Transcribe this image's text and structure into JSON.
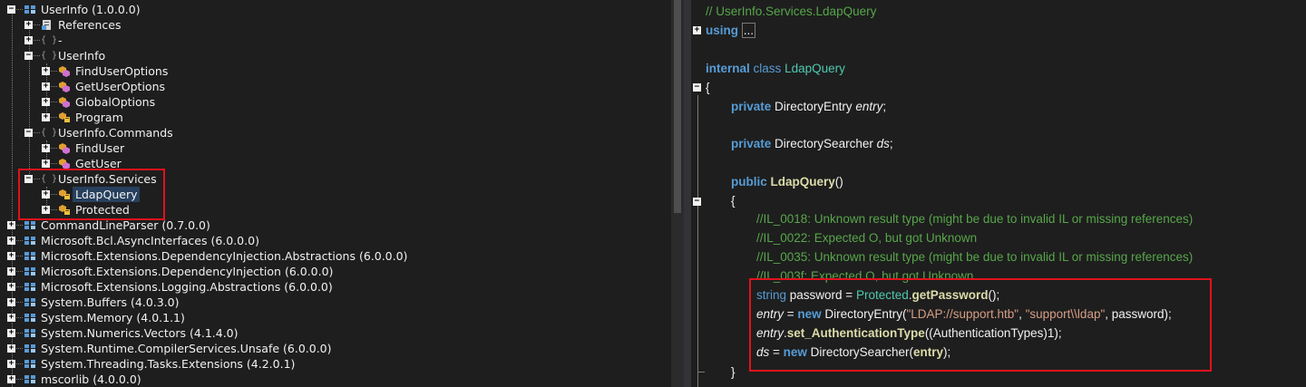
{
  "tree": {
    "items": [
      {
        "label": "UserInfo (1.0.0.0)",
        "level": 0,
        "icon": "assembly-icon",
        "state": "expanded"
      },
      {
        "label": "References",
        "level": 1,
        "icon": "references-icon",
        "state": "collapsed"
      },
      {
        "label": "-",
        "level": 1,
        "icon": "namespace-icon",
        "state": "collapsed"
      },
      {
        "label": "UserInfo",
        "level": 1,
        "icon": "namespace-icon",
        "state": "expanded"
      },
      {
        "label": "FindUserOptions",
        "level": 2,
        "icon": "class-icon",
        "state": "collapsed"
      },
      {
        "label": "GetUserOptions",
        "level": 2,
        "icon": "class-icon",
        "state": "collapsed"
      },
      {
        "label": "GlobalOptions",
        "level": 2,
        "icon": "class-icon",
        "state": "collapsed"
      },
      {
        "label": "Program",
        "level": 2,
        "icon": "internal-class-icon",
        "state": "collapsed"
      },
      {
        "label": "UserInfo.Commands",
        "level": 1,
        "icon": "namespace-icon",
        "state": "expanded"
      },
      {
        "label": "FindUser",
        "level": 2,
        "icon": "class-icon",
        "state": "collapsed"
      },
      {
        "label": "GetUser",
        "level": 2,
        "icon": "class-icon",
        "state": "collapsed"
      },
      {
        "label": "UserInfo.Services",
        "level": 1,
        "icon": "namespace-icon",
        "state": "expanded"
      },
      {
        "label": "LdapQuery",
        "level": 2,
        "icon": "internal-class-icon",
        "state": "collapsed",
        "selected": true
      },
      {
        "label": "Protected",
        "level": 2,
        "icon": "internal-class-icon",
        "state": "collapsed"
      },
      {
        "label": "CommandLineParser (0.7.0.0)",
        "level": 0,
        "icon": "assembly-icon",
        "state": "collapsed"
      },
      {
        "label": "Microsoft.Bcl.AsyncInterfaces (6.0.0.0)",
        "level": 0,
        "icon": "assembly-icon",
        "state": "collapsed"
      },
      {
        "label": "Microsoft.Extensions.DependencyInjection.Abstractions (6.0.0.0)",
        "level": 0,
        "icon": "assembly-icon",
        "state": "collapsed"
      },
      {
        "label": "Microsoft.Extensions.DependencyInjection (6.0.0.0)",
        "level": 0,
        "icon": "assembly-icon",
        "state": "collapsed"
      },
      {
        "label": "Microsoft.Extensions.Logging.Abstractions (6.0.0.0)",
        "level": 0,
        "icon": "assembly-icon",
        "state": "collapsed"
      },
      {
        "label": "System.Buffers (4.0.3.0)",
        "level": 0,
        "icon": "assembly-icon",
        "state": "collapsed"
      },
      {
        "label": "System.Memory (4.0.1.1)",
        "level": 0,
        "icon": "assembly-icon",
        "state": "collapsed"
      },
      {
        "label": "System.Numerics.Vectors (4.1.4.0)",
        "level": 0,
        "icon": "assembly-icon",
        "state": "collapsed"
      },
      {
        "label": "System.Runtime.CompilerServices.Unsafe (6.0.0.0)",
        "level": 0,
        "icon": "assembly-icon",
        "state": "collapsed"
      },
      {
        "label": "System.Threading.Tasks.Extensions (4.2.0.1)",
        "level": 0,
        "icon": "assembly-icon",
        "state": "collapsed"
      },
      {
        "label": "mscorlib (4.0.0.0)",
        "level": 0,
        "icon": "assembly-icon",
        "state": "collapsed"
      }
    ]
  },
  "code": {
    "header_comment": "// UserInfo.Services.LdapQuery",
    "using_kw": "using",
    "using_ellipsis": "...",
    "class_kw1": "internal",
    "class_kw2": "class",
    "class_name": "LdapQuery",
    "open_brace": "{",
    "field1_kw": "private",
    "field1_type": "DirectoryEntry",
    "field1_name": "entry",
    "field2_kw": "private",
    "field2_type": "DirectorySearcher",
    "field2_name": "ds",
    "ctor_kw": "public",
    "ctor_name": "LdapQuery",
    "ctor_parens": "()",
    "ctor_open": "{",
    "comments": [
      "//IL_0018: Unknown result type (might be due to invalid IL or missing references)",
      "//IL_0022: Expected O, but got Unknown",
      "//IL_0035: Unknown result type (might be due to invalid IL or missing references)",
      "//IL_003f: Expected O, but got Unknown"
    ],
    "l1": {
      "t1": "string",
      "t2": " password = ",
      "t3": "Protected",
      "t4": ".",
      "t5": "getPassword",
      "t6": "();"
    },
    "l2": {
      "t1": "entry",
      "t2": " = ",
      "t3": "new",
      "t4": " DirectoryEntry(",
      "t5": "\"LDAP://support.htb\"",
      "t6": ", ",
      "t7": "\"support\\\\ldap\"",
      "t8": ", password);"
    },
    "l3": {
      "t1": "entry",
      "t2": ".",
      "t3": "set_AuthenticationType",
      "t4": "((AuthenticationTypes)1);"
    },
    "l4": {
      "t1": "ds",
      "t2": " = ",
      "t3": "new",
      "t4": " DirectorySearcher(",
      "t5": "entry",
      "t6": ");"
    },
    "ctor_close": "}"
  },
  "colors": {
    "highlight_box": "#e0121c",
    "selection": "#27405e",
    "keyword": "#569cd6",
    "type": "#4ec9b0",
    "comment": "#57a64a",
    "string": "#d69d85"
  }
}
